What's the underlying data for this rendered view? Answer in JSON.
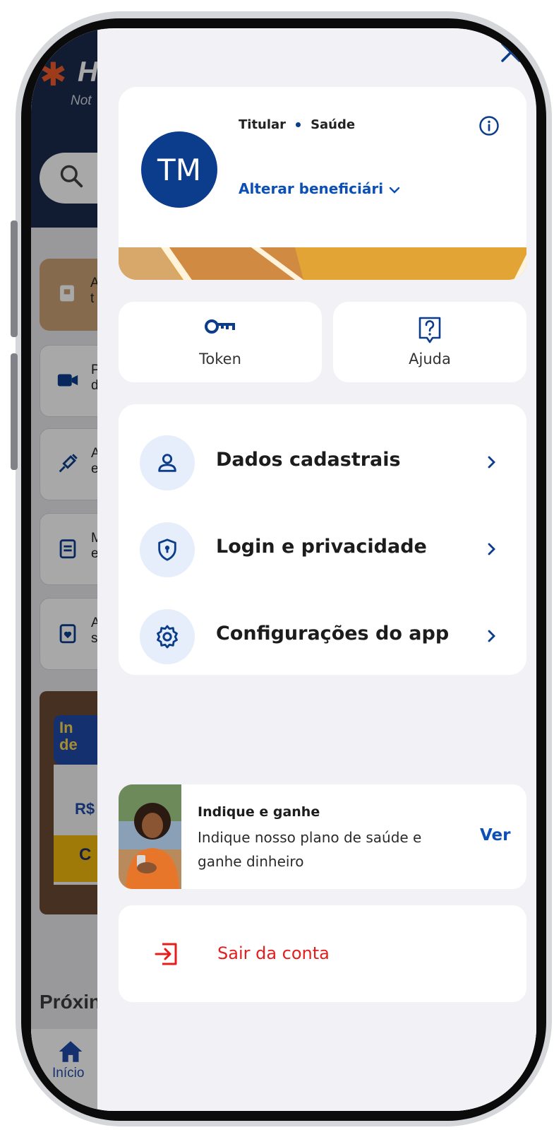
{
  "background_app": {
    "logo_text": "H",
    "logo_subtitle": "Not",
    "cards": [
      {
        "label": "A\nt"
      },
      {
        "label": "P\nd"
      },
      {
        "label": "A\ne"
      },
      {
        "label": "M\ne"
      },
      {
        "label": "A\ns"
      }
    ],
    "banner_text": "In\nde",
    "banner_price": "R$",
    "banner_cta": "C",
    "section_heading": "Próxin",
    "tabbar": {
      "home_label": "Início"
    }
  },
  "drawer": {
    "profile": {
      "initials": "TM",
      "role": "Titular",
      "plan": "Saúde",
      "change_beneficiary": "Alterar beneficiári"
    },
    "quick_actions": [
      {
        "label": "Token",
        "icon": "key-icon"
      },
      {
        "label": "Ajuda",
        "icon": "help-icon"
      }
    ],
    "menu": [
      {
        "label": "Dados cadastrais",
        "icon": "person-icon"
      },
      {
        "label": "Login e privacidade",
        "icon": "shield-icon"
      },
      {
        "label": "Configurações do app",
        "icon": "gear-icon"
      }
    ],
    "promo": {
      "title": "Indique e ganhe",
      "description": "Indique nosso plano de saúde e ganhe dinheiro",
      "action": "Ver"
    },
    "logout": {
      "label": "Sair da conta"
    }
  },
  "colors": {
    "brand_blue": "#0c3d8c",
    "link_blue": "#0c4fb6",
    "danger_red": "#e41d1d",
    "drawer_background": "#f2f1f6"
  }
}
